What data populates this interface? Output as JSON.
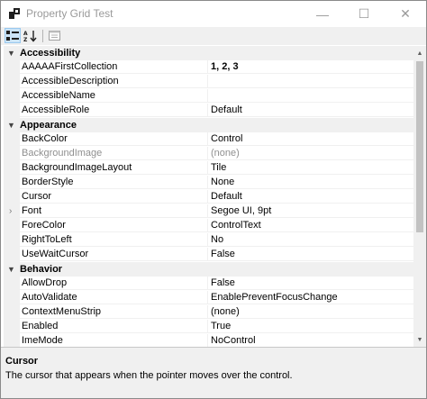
{
  "window": {
    "title": "Property Grid Test",
    "controls": {
      "minimize": "—",
      "maximize": "☐",
      "close": "✕"
    }
  },
  "toolbar": {
    "buttons": [
      {
        "name": "categorized",
        "active": true
      },
      {
        "name": "alphabetical",
        "active": false
      },
      {
        "name": "property-pages",
        "active": false
      }
    ]
  },
  "grid": {
    "rows": [
      {
        "type": "category",
        "label": "Accessibility"
      },
      {
        "type": "prop",
        "name": "AAAAAFirstCollection",
        "value": "1, 2, 3",
        "bold": true
      },
      {
        "type": "prop",
        "name": "AccessibleDescription",
        "value": ""
      },
      {
        "type": "prop",
        "name": "AccessibleName",
        "value": ""
      },
      {
        "type": "prop",
        "name": "AccessibleRole",
        "value": "Default"
      },
      {
        "type": "category",
        "label": "Appearance"
      },
      {
        "type": "prop",
        "name": "BackColor",
        "value": "Control"
      },
      {
        "type": "prop",
        "name": "BackgroundImage",
        "value": "(none)",
        "dim": true
      },
      {
        "type": "prop",
        "name": "BackgroundImageLayout",
        "value": "Tile"
      },
      {
        "type": "prop",
        "name": "BorderStyle",
        "value": "None"
      },
      {
        "type": "prop",
        "name": "Cursor",
        "value": "Default"
      },
      {
        "type": "prop",
        "name": "Font",
        "value": "Segoe UI, 9pt",
        "expandable": true
      },
      {
        "type": "prop",
        "name": "ForeColor",
        "value": "ControlText"
      },
      {
        "type": "prop",
        "name": "RightToLeft",
        "value": "No"
      },
      {
        "type": "prop",
        "name": "UseWaitCursor",
        "value": "False"
      },
      {
        "type": "category",
        "label": "Behavior"
      },
      {
        "type": "prop",
        "name": "AllowDrop",
        "value": "False"
      },
      {
        "type": "prop",
        "name": "AutoValidate",
        "value": "EnablePreventFocusChange"
      },
      {
        "type": "prop",
        "name": "ContextMenuStrip",
        "value": "(none)"
      },
      {
        "type": "prop",
        "name": "Enabled",
        "value": "True"
      },
      {
        "type": "prop",
        "name": "ImeMode",
        "value": "NoControl"
      }
    ]
  },
  "help": {
    "title": "Cursor",
    "description": "The cursor that appears when the pointer moves over the control."
  },
  "colors": {
    "category_bg": "#f0f0f0",
    "grid_line": "#f0f0f0",
    "active_button": "#cce4f7",
    "dim_text": "#8f8f8f"
  }
}
